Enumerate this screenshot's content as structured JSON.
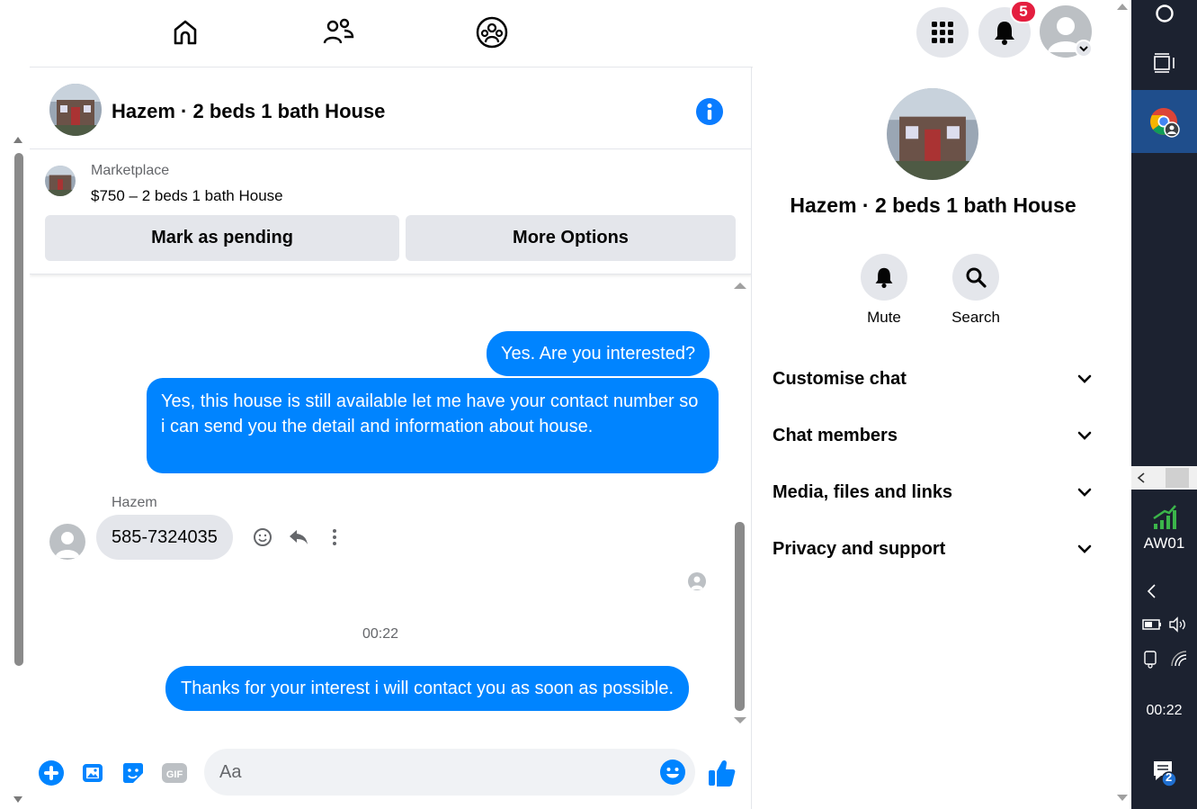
{
  "topbar": {
    "nav_icons": [
      "home-icon",
      "friends-icon",
      "groups-icon"
    ],
    "notification_count": "5"
  },
  "chat": {
    "title": "Hazem · 2 beds 1 bath House",
    "marketplace": {
      "source": "Marketplace",
      "item": "$750 – 2 beds 1 bath House",
      "mark_pending_label": "Mark as pending",
      "more_options_label": "More Options"
    },
    "messages": [
      {
        "from": "me",
        "text": "Yes. Are you interested?"
      },
      {
        "from": "me",
        "text": "Yes, this house is still available let me have your contact number so i can send you the detail and information about house."
      },
      {
        "from": "Hazem",
        "text": "585-7324035"
      },
      {
        "from": "me",
        "text": "Thanks for your interest i will contact you as soon as possible."
      }
    ],
    "sender_name": "Hazem",
    "timestamp": "00:22",
    "composer": {
      "placeholder": "Aa"
    }
  },
  "details": {
    "title": "Hazem · 2 beds 1 bath House",
    "actions": [
      {
        "label": "Mute"
      },
      {
        "label": "Search"
      }
    ],
    "sections": [
      "Customise chat",
      "Chat members",
      "Media, files and links",
      "Privacy and support"
    ]
  },
  "taskbar": {
    "app_label": "AW01",
    "time": "00:22",
    "notification_count": "2"
  },
  "colors": {
    "accent": "#0084ff",
    "info": "#0a7cff",
    "badge": "#e41e3f",
    "gray_button": "#e4e6eb",
    "taskbar": "#1c2230"
  }
}
